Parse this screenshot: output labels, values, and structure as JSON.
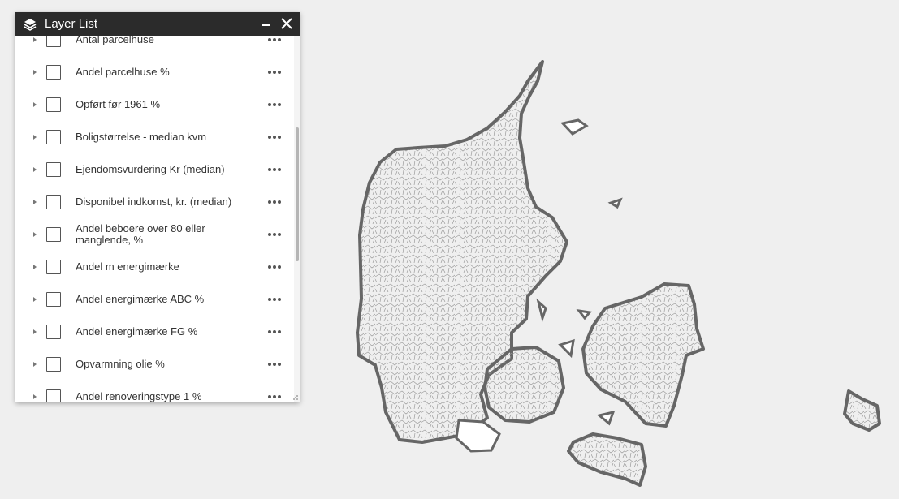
{
  "panel": {
    "title": "Layer List",
    "icons": {
      "header": "layers-icon",
      "minimize": "minimize-icon",
      "close": "close-icon",
      "row_menu": "more-options-icon",
      "expand": "caret-right-icon"
    },
    "layers": [
      {
        "label": "Antal parcelhuse",
        "checked": false
      },
      {
        "label": "Andel parcelhuse %",
        "checked": false
      },
      {
        "label": "Opført før 1961 %",
        "checked": false
      },
      {
        "label": "Boligstørrelse - median kvm",
        "checked": false
      },
      {
        "label": "Ejendomsvurdering Kr (median)",
        "checked": false
      },
      {
        "label": "Disponibel indkomst, kr. (median)",
        "checked": false
      },
      {
        "label": "Andel beboere over 80 eller manglende, %",
        "checked": false
      },
      {
        "label": "Andel m energimærke",
        "checked": false
      },
      {
        "label": "Andel energimærke ABC %",
        "checked": false
      },
      {
        "label": "Andel energimærke FG %",
        "checked": false
      },
      {
        "label": "Opvarmning olie %",
        "checked": false
      },
      {
        "label": "Andel renoveringstype 1 %",
        "checked": false
      }
    ]
  },
  "map": {
    "region": "Denmark municipalities",
    "colors": {
      "background": "#efefef",
      "land_fill": "#ffffff",
      "outline": "#666666"
    }
  }
}
